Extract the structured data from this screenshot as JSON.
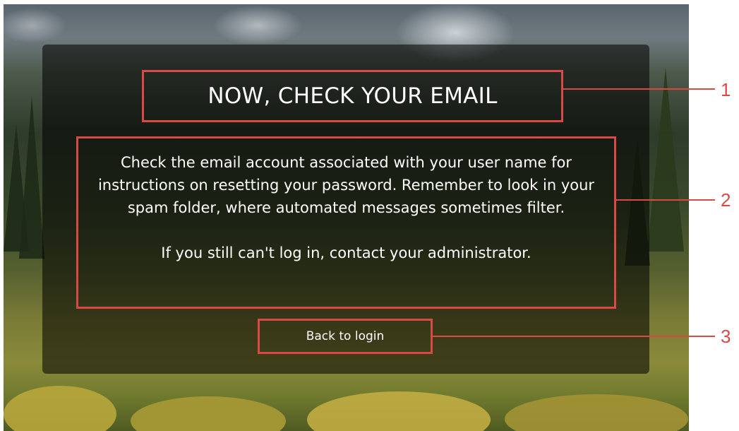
{
  "reset_confirmation": {
    "title": "NOW, CHECK YOUR EMAIL",
    "paragraph_1": "Check the email account associated with your user name for instructions on resetting your password. Remember to look in your spam folder, where automated messages sometimes filter.",
    "paragraph_2": "If you still can't log in, contact your administrator.",
    "back_link": "Back to login"
  },
  "callouts": [
    "1",
    "2",
    "3"
  ],
  "colors": {
    "callout": "#d94a45",
    "panel_overlay": "rgba(0,0,0,0.55)",
    "text": "#ffffff"
  }
}
